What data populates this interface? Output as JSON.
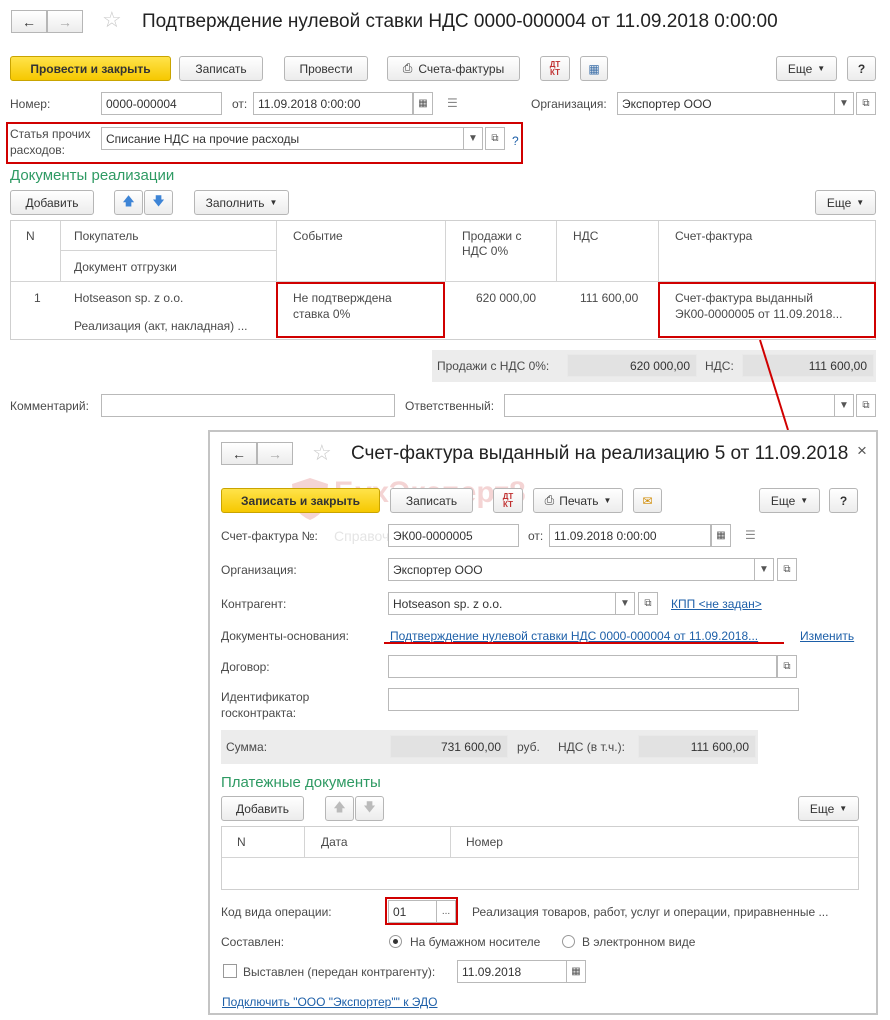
{
  "main": {
    "title": "Подтверждение нулевой ставки НДС 0000-000004 от 11.09.2018 0:00:00",
    "toolbar": {
      "post_close": "Провести и закрыть",
      "save": "Записать",
      "post": "Провести",
      "invoices": "Счета-фактуры",
      "more": "Еще",
      "help": "?"
    },
    "number_label": "Номер:",
    "number_value": "0000-000004",
    "date_label": "от:",
    "date_value": "11.09.2018  0:00:00",
    "org_label": "Организация:",
    "org_value": "Экспортер ООО",
    "expense_label_1": "Статья прочих",
    "expense_label_2": "расходов:",
    "expense_value": "Списание НДС на прочие расходы",
    "expense_help": "?",
    "section_title": "Документы реализации",
    "add": "Добавить",
    "fill": "Заполнить",
    "more2": "Еще",
    "table": {
      "col_n": "N",
      "col_buyer": "Покупатель",
      "col_shipdoc": "Документ отгрузки",
      "col_event": "Событие",
      "col_sales_1": "Продажи с",
      "col_sales_2": "НДС 0%",
      "col_vat": "НДС",
      "col_invoice": "Счет-фактура",
      "rows": [
        {
          "n": "1",
          "buyer": "Hotseason sp. z o.o.",
          "shipdoc": "Реализация (акт, накладная) ...",
          "event_1": "Не подтверждена",
          "event_2": "ставка 0%",
          "sales": "620 000,00",
          "vat": "111 600,00",
          "invoice_1": "Счет-фактура выданный",
          "invoice_2": "ЭК00-0000005 от 11.09.2018..."
        }
      ]
    },
    "totals": {
      "sales_label": "Продажи с НДС 0%:",
      "sales_value": "620 000,00",
      "vat_label": "НДС:",
      "vat_value": "111 600,00"
    },
    "comment_label": "Комментарий:",
    "responsible_label": "Ответственный:"
  },
  "invoice": {
    "title": "Счет-фактура выданный на реализацию 5 от 11.09.2018",
    "close": "×",
    "toolbar": {
      "save_close": "Записать и закрыть",
      "save": "Записать",
      "print": "Печать",
      "more": "Еще",
      "help": "?"
    },
    "num_label": "Счет-фактура №:",
    "num_value": "ЭК00-0000005",
    "date_label": "от:",
    "date_value": "11.09.2018  0:00:00",
    "org_label": "Организация:",
    "org_value": "Экспортер ООО",
    "contr_label": "Контрагент:",
    "contr_value": "Hotseason sp. z o.o.",
    "kpp_link": "КПП <не задан>",
    "basis_label": "Документы-основания:",
    "basis_link": "Подтверждение нулевой ставки НДС 0000-000004 от 11.09.2018...",
    "change_link": "Изменить",
    "contract_label": "Договор:",
    "gov_label_1": "Идентификатор",
    "gov_label_2": "госконтракта:",
    "sum_label": "Сумма:",
    "sum_value": "731 600,00",
    "currency": "руб.",
    "vat_label": "НДС (в т.ч.):",
    "vat_value": "111 600,00",
    "payments_title": "Платежные документы",
    "add": "Добавить",
    "more2": "Еще",
    "pay_table": {
      "col_n": "N",
      "col_date": "Дата",
      "col_number": "Номер"
    },
    "op_label": "Код вида операции:",
    "op_value": "01",
    "op_dots": "...",
    "op_desc": "Реализация товаров, работ, услуг и операции, приравненные ...",
    "made_label": "Составлен:",
    "paper": "На бумажном носителе",
    "electronic": "В электронном виде",
    "issued_label": "Выставлен (передан контрагенту):",
    "issued_date": "11.09.2018",
    "edo_link": "Подключить \"ООО \"Экспортер\"\" к ЭДО",
    "watermark": "БухЭксперт8",
    "watermark_sub": "Справочная система"
  }
}
